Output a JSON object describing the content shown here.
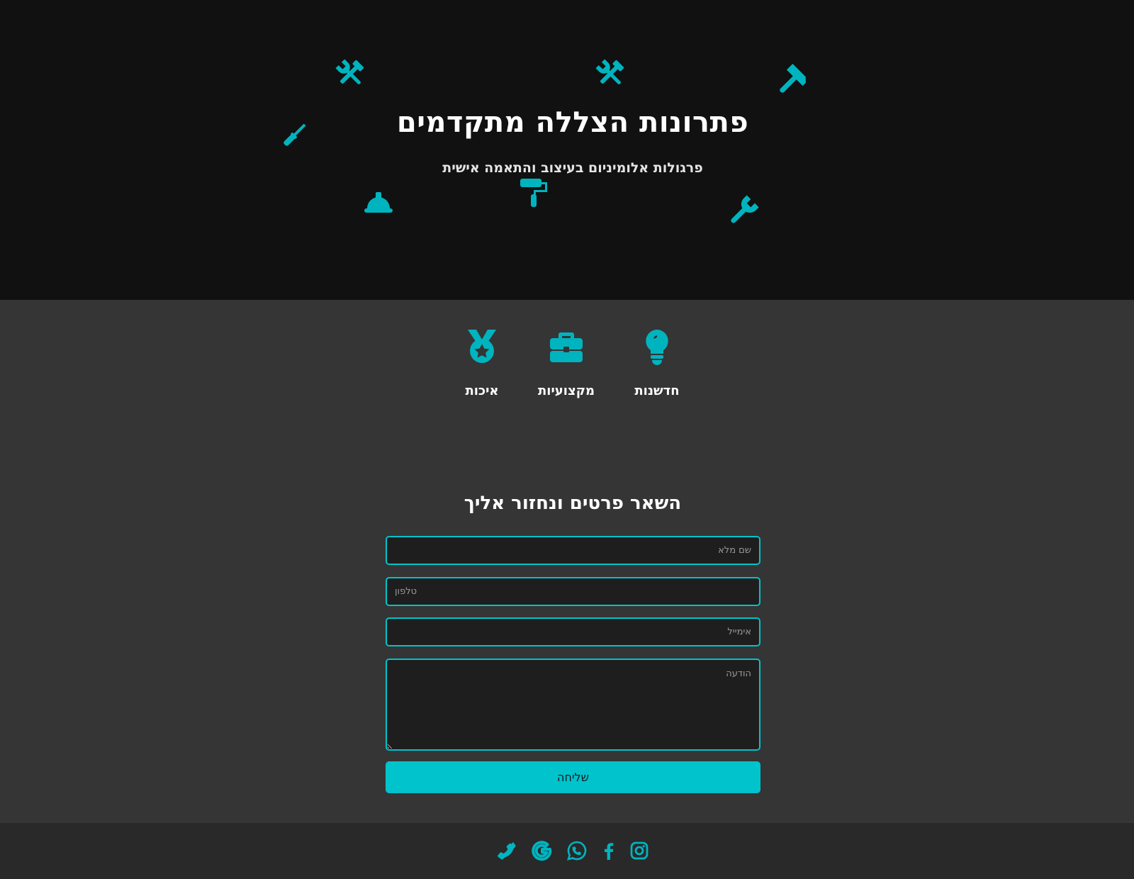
{
  "hero": {
    "title": "פתרונות הצללה מתקדמים",
    "subtitle": "פרגולות אלומיניום בעיצוב והתאמה אישית",
    "decorative_icons": [
      "tools-icon",
      "tools-icon",
      "hammer-icon",
      "screwdriver-icon",
      "hard-hat-icon",
      "paint-roller-icon",
      "wrench-icon"
    ]
  },
  "features": [
    {
      "label": "חדשנות",
      "icon": "lightbulb-icon"
    },
    {
      "label": "מקצועיות",
      "icon": "briefcase-icon"
    },
    {
      "label": "איכות",
      "icon": "award-medal-icon"
    }
  ],
  "form": {
    "title": "השאר פרטים ונחזור אליך",
    "name_placeholder": "שם מלא",
    "phone_placeholder": "טלפון",
    "email_placeholder": "אימייל",
    "message_placeholder": "הודעה",
    "submit_label": "שליחה"
  },
  "footer": {
    "social_icons": [
      "phone-icon",
      "google-icon",
      "whatsapp-icon",
      "facebook-icon",
      "instagram-icon"
    ]
  },
  "colors": {
    "accent": "#00c3cc",
    "hero_bg": "#111111",
    "section_bg": "#353535",
    "footer_bg": "#292929",
    "input_bg": "#1e1e1e"
  }
}
